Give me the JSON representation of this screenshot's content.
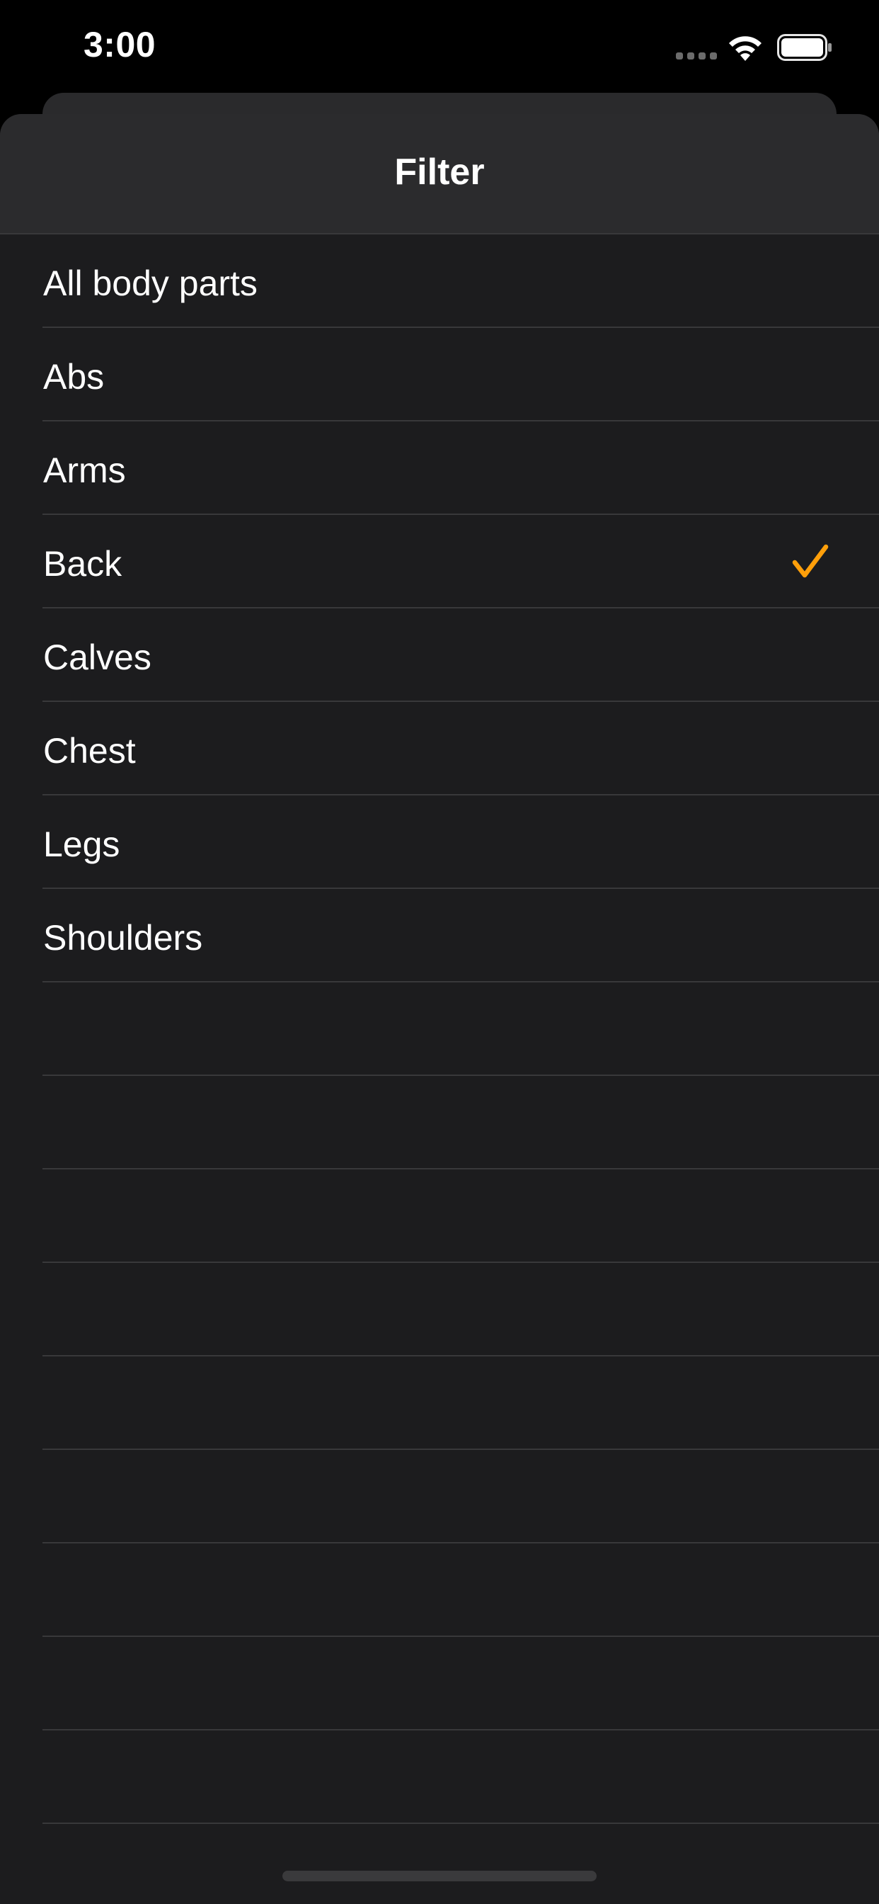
{
  "status_bar": {
    "time": "3:00",
    "signal_icon": "cellular-signal-icon",
    "wifi_icon": "wifi-icon",
    "battery_icon": "battery-icon"
  },
  "sheet": {
    "title": "Filter"
  },
  "filter_list": {
    "items": [
      {
        "label": "All body parts",
        "selected": false
      },
      {
        "label": "Abs",
        "selected": false
      },
      {
        "label": "Arms",
        "selected": false
      },
      {
        "label": "Back",
        "selected": true
      },
      {
        "label": "Calves",
        "selected": false
      },
      {
        "label": "Chest",
        "selected": false
      },
      {
        "label": "Legs",
        "selected": false
      },
      {
        "label": "Shoulders",
        "selected": false
      }
    ],
    "selected_icon": "checkmark-icon"
  },
  "colors": {
    "background": "#000000",
    "sheet": "#1c1c1e",
    "header": "#2b2b2d",
    "separator": "#38383a",
    "accent": "#ff9f0a",
    "text": "#ffffff"
  }
}
